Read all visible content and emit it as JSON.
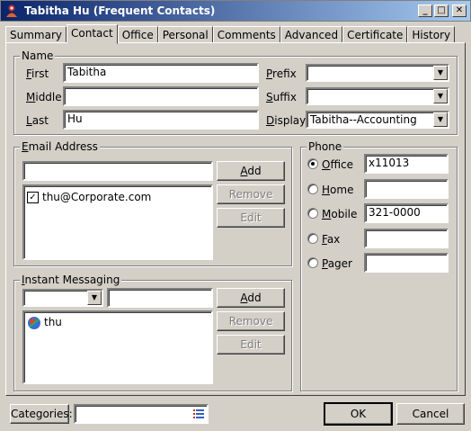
{
  "window": {
    "title": "Tabitha Hu (Frequent Contacts)",
    "min": "_",
    "max": "□",
    "close": "✕"
  },
  "tabs": [
    "Summary",
    "Contact",
    "Office",
    "Personal",
    "Comments",
    "Advanced",
    "Certificate",
    "History"
  ],
  "active_tab": "Contact",
  "name": {
    "label": "Name",
    "first_label": "First",
    "first": "Tabitha",
    "middle_label": "Middle",
    "middle": "",
    "last_label": "Last",
    "last": "Hu",
    "prefix_label": "Prefix",
    "prefix": "",
    "suffix_label": "Suffix",
    "suffix": "",
    "display_label": "Display",
    "display": "Tabitha--Accounting"
  },
  "email": {
    "label": "Email Address",
    "input": "",
    "items": [
      {
        "address": "thu@Corporate.com",
        "checked": true
      }
    ],
    "add": "Add",
    "remove": "Remove",
    "edit": "Edit"
  },
  "im": {
    "label": "Instant Messaging",
    "service": "",
    "handle": "",
    "items": [
      "thu"
    ],
    "add": "Add",
    "remove": "Remove",
    "edit": "Edit"
  },
  "phone": {
    "label": "Phone",
    "rows": [
      {
        "label": "Office",
        "value": "x11013",
        "selected": true
      },
      {
        "label": "Home",
        "value": "",
        "selected": false
      },
      {
        "label": "Mobile",
        "value": "321-0000",
        "selected": false
      },
      {
        "label": "Fax",
        "value": "",
        "selected": false
      },
      {
        "label": "Pager",
        "value": "",
        "selected": false
      }
    ]
  },
  "footer": {
    "categories_label": "Categories:",
    "categories": "",
    "ok": "OK",
    "cancel": "Cancel"
  }
}
